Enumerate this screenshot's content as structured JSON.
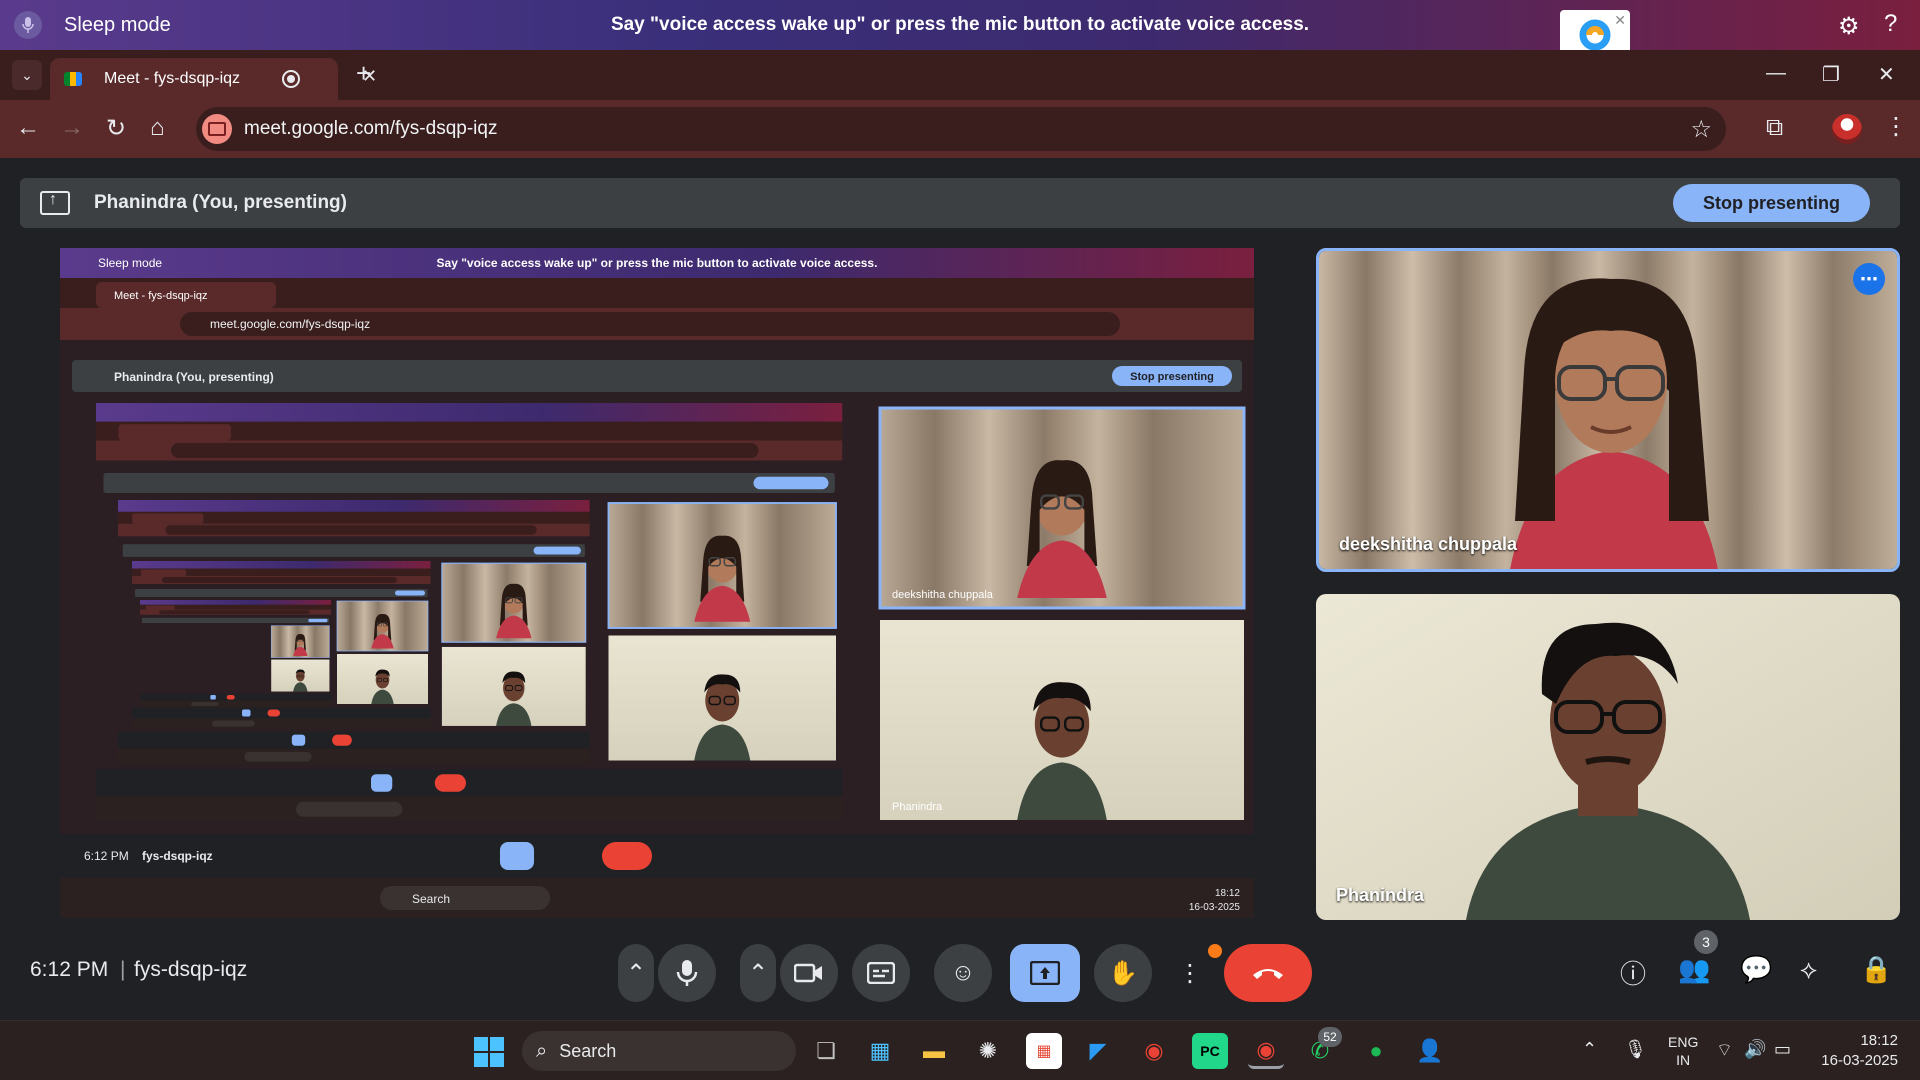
{
  "voice_access": {
    "status": "Sleep mode",
    "message": "Say \"voice access wake up\" or press the mic button to activate voice access."
  },
  "browser": {
    "tab_title": "Meet - fys-dsqp-iqz",
    "url": "meet.google.com/fys-dsqp-iqz",
    "icons": [
      "tab-list-icon",
      "record-icon",
      "close-icon",
      "new-tab-icon",
      "minimize-icon",
      "restore-icon",
      "window-close-icon",
      "back-icon",
      "forward-icon",
      "reload-icon",
      "home-icon",
      "bookmark-star-icon",
      "extensions-icon",
      "profile-avatar",
      "more-menu-icon"
    ]
  },
  "meet": {
    "presenter_banner": "Phanindra (You, presenting)",
    "stop_presenting": "Stop presenting",
    "participants": [
      {
        "name": "deekshitha chuppala"
      },
      {
        "name": "Phanindra"
      }
    ],
    "controls": {
      "time": "6:12 PM",
      "separator": "|",
      "meeting_code": "fys-dsqp-iqz",
      "people_count": "3"
    },
    "colors": {
      "accent": "#8ab4f8",
      "end_call": "#ea4335",
      "background": "#202124"
    }
  },
  "taskbar": {
    "search_label": "Search",
    "whatsapp_badge": "52",
    "language": "ENG",
    "region": "IN",
    "time": "18:12",
    "date": "16-03-2025"
  }
}
